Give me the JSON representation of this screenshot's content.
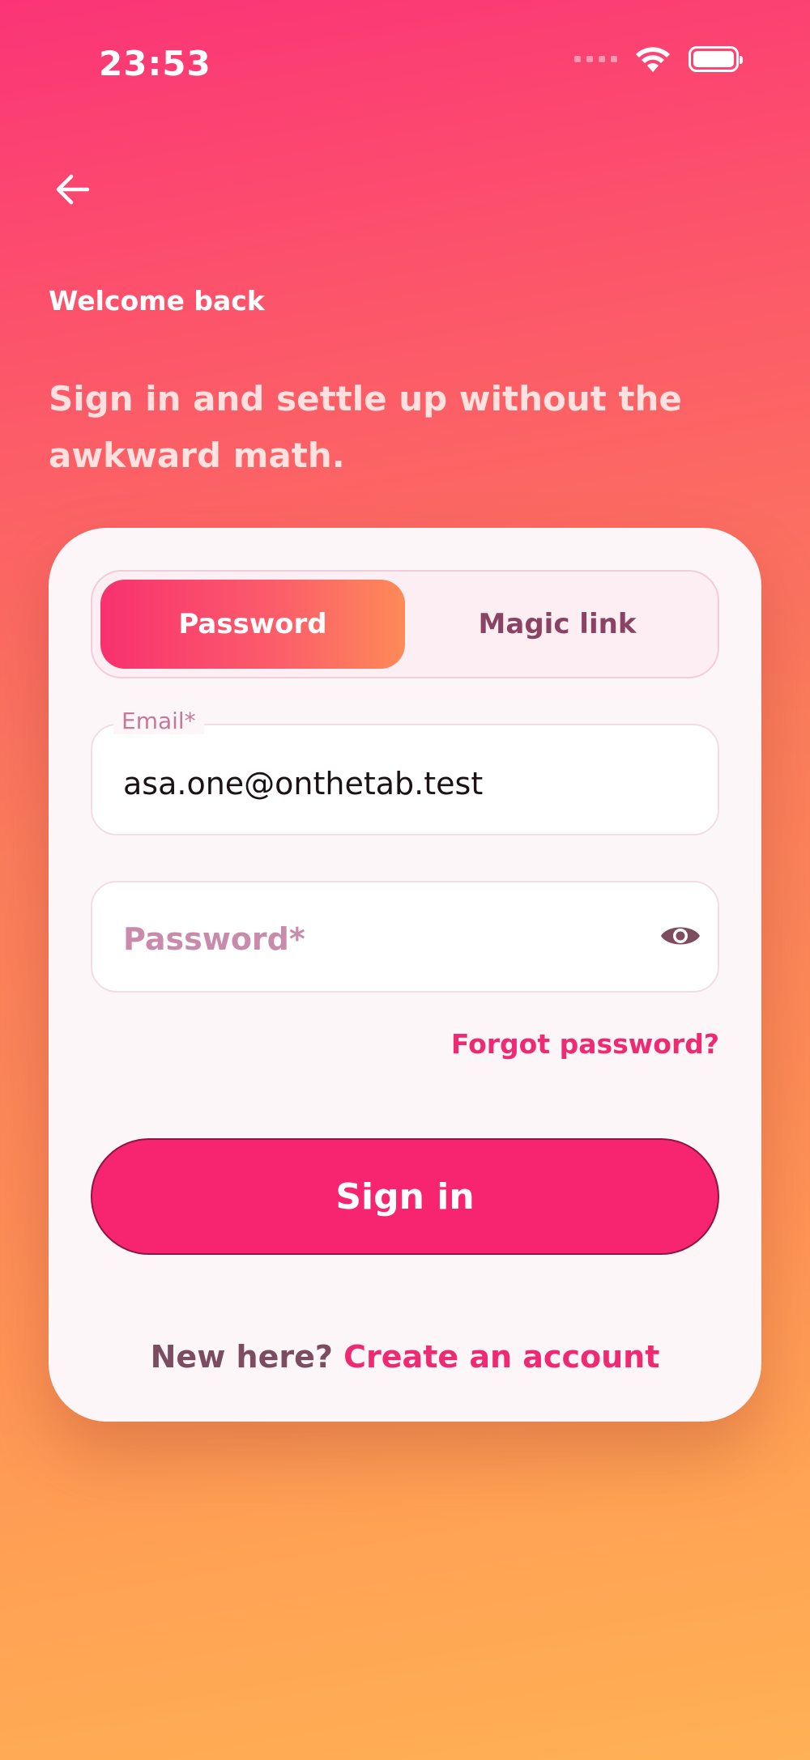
{
  "status_bar": {
    "time": "23:53",
    "icons": [
      "cellular-signal-icon",
      "wifi-icon",
      "battery-icon"
    ]
  },
  "header": {
    "back_icon": "arrow-left-icon",
    "eyebrow": "Welcome back",
    "headline": "Sign in and settle up without the awkward math."
  },
  "tabs": [
    {
      "label": "Password",
      "active": true
    },
    {
      "label": "Magic link",
      "active": false
    }
  ],
  "form": {
    "email": {
      "label": "Email*",
      "value": "asa.one@onthetab.test"
    },
    "password": {
      "placeholder": "Password*",
      "value": "",
      "toggle_icon": "eye-icon"
    },
    "forgot_label": "Forgot password?",
    "submit_label": "Sign in"
  },
  "footer": {
    "prompt": "New here?",
    "link": "Create an account"
  },
  "colors": {
    "accent": "#f72470",
    "link": "#ef2a72",
    "card": "#fdf6f8",
    "gradient_top": "#fb3477",
    "gradient_bottom": "#ffb155"
  }
}
